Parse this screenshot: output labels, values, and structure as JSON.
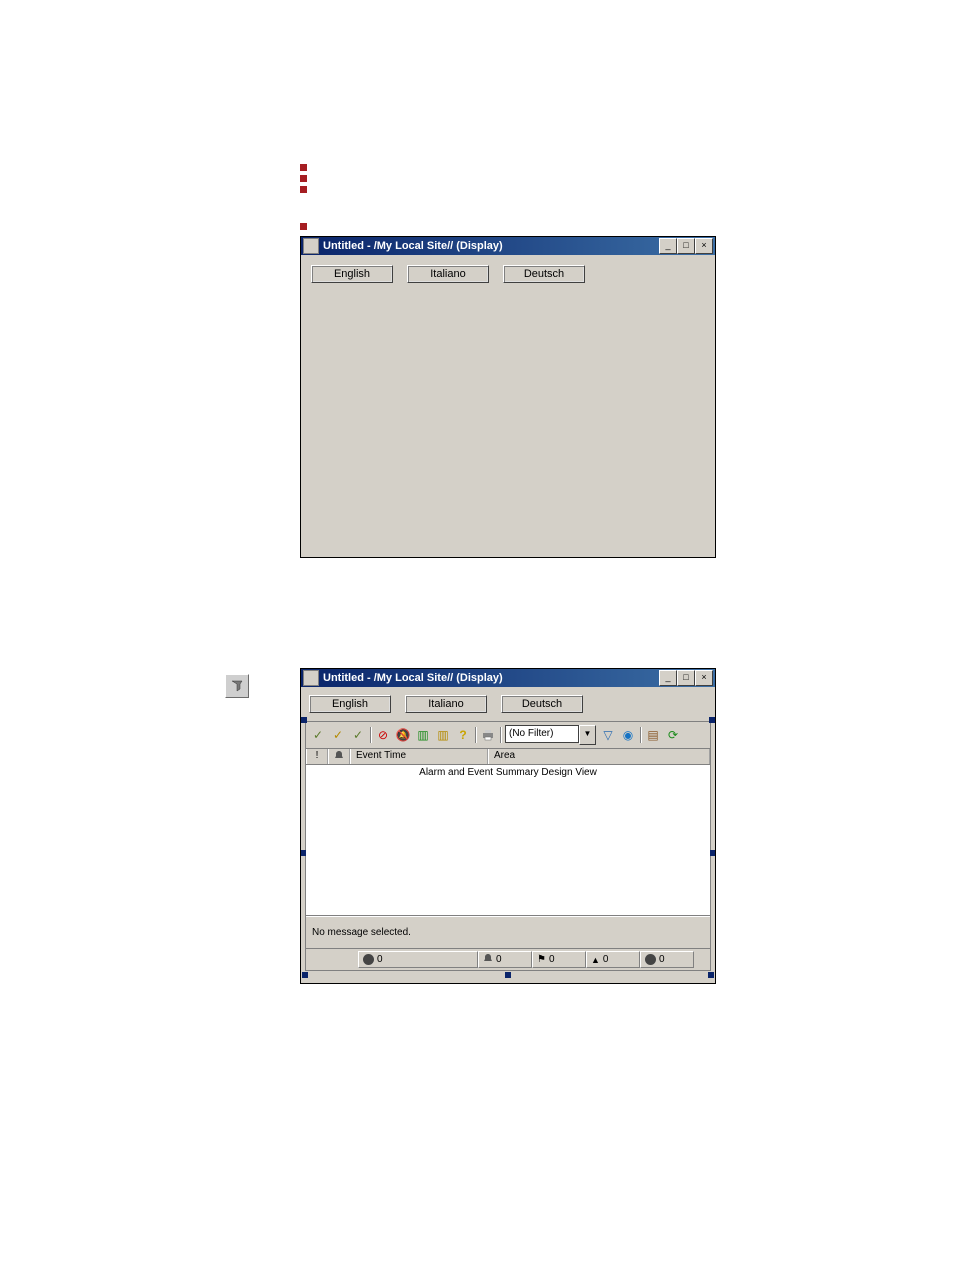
{
  "window1": {
    "title": "Untitled - /My Local Site// (Display)",
    "buttons": {
      "english": "English",
      "italiano": "Italiano",
      "deutsch": "Deutsch"
    }
  },
  "window2": {
    "title": "Untitled - /My Local Site// (Display)",
    "buttons": {
      "english": "English",
      "italiano": "Italiano",
      "deutsch": "Deutsch"
    },
    "filter_text": "(No Filter)",
    "columns": {
      "event_time": "Event Time",
      "area": "Area"
    },
    "design_view": "Alarm and Event Summary Design View",
    "no_message": "No message selected.",
    "status": {
      "v1": "0",
      "v2": "0",
      "v3": "0",
      "v4": "0",
      "v5": "0"
    }
  },
  "win_controls": {
    "min": "_",
    "max": "□",
    "close": "×"
  }
}
